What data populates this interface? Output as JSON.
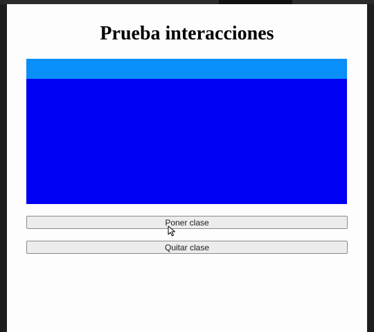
{
  "page": {
    "title": "Prueba interacciones"
  },
  "colors": {
    "header_band": "#0a8ef8",
    "box_body": "#0000f5",
    "page_background": "#fdfdfd"
  },
  "buttons": {
    "add_class_label": "Poner clase",
    "remove_class_label": "Quitar clase"
  },
  "cursor": {
    "icon": "mouse-pointer-icon"
  }
}
